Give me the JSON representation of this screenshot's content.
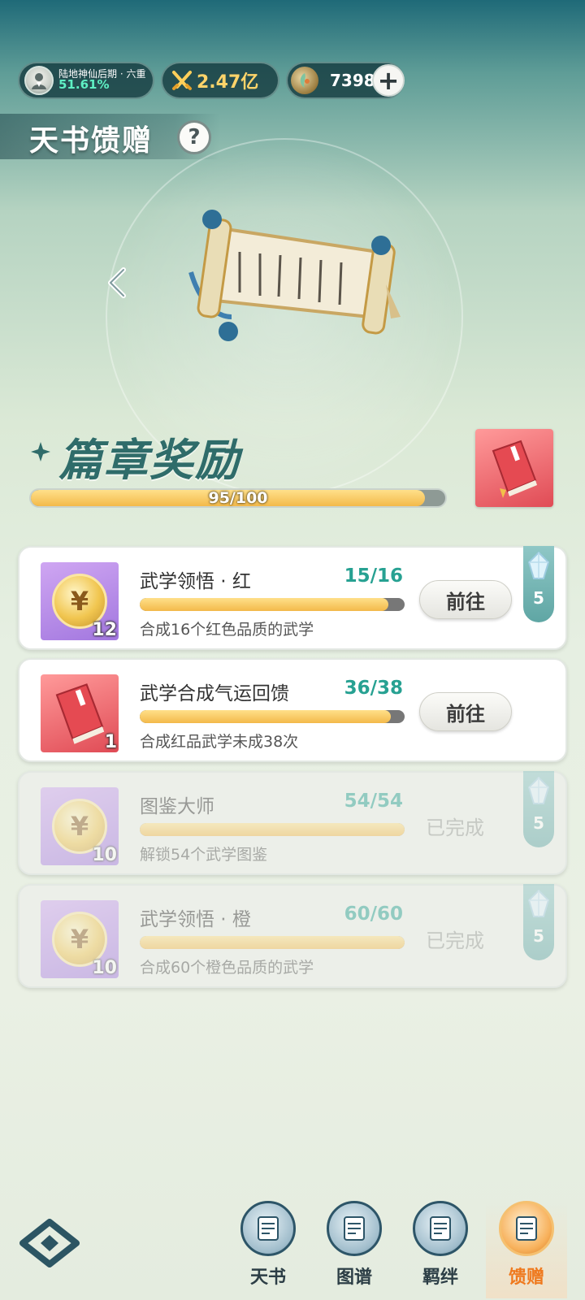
{
  "status": {
    "realm_name": "陆地神仙后期 · 六重",
    "realm_progress": "51.61%",
    "combat_power": "2.47亿",
    "currency": "7398",
    "add_label": "+"
  },
  "page": {
    "title": "天书馈赠",
    "help_label": "?"
  },
  "chapter": {
    "title": "篇章奖励",
    "progress_text": "95/100",
    "progress_value": 0.95
  },
  "tasks": [
    {
      "name": "武学领悟 · 红",
      "count": "15/16",
      "progress": 0.9375,
      "desc": "合成16个红色品质的武学",
      "item_count": "12",
      "item_color": "purple",
      "action": "前往",
      "completed": false,
      "gem": "5"
    },
    {
      "name": "武学合成气运回馈",
      "count": "36/38",
      "progress": 0.947,
      "desc": "合成红品武学未成38次",
      "item_count": "1",
      "item_color": "red",
      "action": "前往",
      "completed": false,
      "gem": ""
    },
    {
      "name": "图鉴大师",
      "count": "54/54",
      "progress": 1.0,
      "desc": "解锁54个武学图鉴",
      "item_count": "10",
      "item_color": "purple",
      "action": "已完成",
      "completed": true,
      "gem": "5"
    },
    {
      "name": "武学领悟 · 橙",
      "count": "60/60",
      "progress": 1.0,
      "desc": "合成60个橙色品质的武学",
      "item_count": "10",
      "item_color": "purple",
      "action": "已完成",
      "completed": true,
      "gem": "5"
    }
  ],
  "nav": [
    {
      "label": "天书",
      "icon": "book-icon",
      "active": false
    },
    {
      "label": "图谱",
      "icon": "atlas-icon",
      "active": false
    },
    {
      "label": "羁绊",
      "icon": "handshake-icon",
      "active": false
    },
    {
      "label": "馈赠",
      "icon": "gift-bag-icon",
      "active": true
    }
  ],
  "colors": {
    "accent_teal": "#27a192",
    "progress_gold": "#f3b94a",
    "active_orange": "#ef7a1f"
  }
}
